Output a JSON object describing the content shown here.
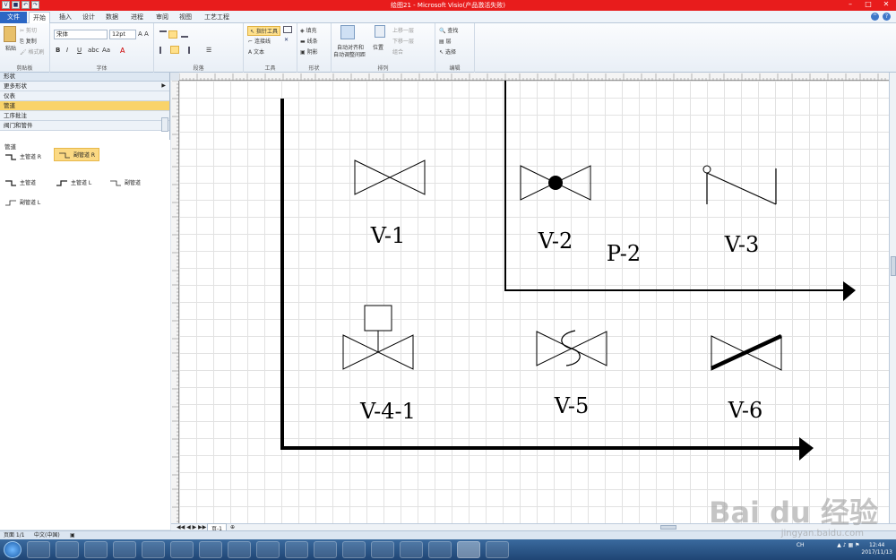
{
  "window": {
    "title": "绘图21 - Microsoft Visio(产品激活失败)"
  },
  "tabs": [
    "文件",
    "开始",
    "插入",
    "设计",
    "数据",
    "进程",
    "审阅",
    "视图",
    "工艺工程"
  ],
  "ribbon": {
    "clipboard": {
      "paste": "粘贴",
      "cut": "剪切",
      "copy": "复制",
      "format_painter": "格式刷",
      "label": "剪贴板"
    },
    "font": {
      "name": "宋体",
      "size": "12pt",
      "label": "字体"
    },
    "paragraph": {
      "label": "段落"
    },
    "tools": {
      "pointer": "指针工具",
      "connector": "连接线",
      "text": "文本",
      "label": "工具"
    },
    "shape": {
      "fill": "填充",
      "line": "线条",
      "shadow": "阴影",
      "label": "形状"
    },
    "arrange": {
      "auto_align": "自动对齐和",
      "auto_space": "自动调整间距",
      "position": "位置",
      "bring_forward": "上移一层",
      "send_backward": "下移一层",
      "group": "组合",
      "label": "排列"
    },
    "editing": {
      "find": "查找",
      "layers": "层",
      "select": "选择",
      "label": "编辑"
    }
  },
  "sidebar": {
    "header": "形状",
    "rows": [
      "更多形状",
      "仪表",
      "管道",
      "工序批注",
      "阀门和管件"
    ],
    "active_index": 2,
    "stencil_title": "管道",
    "shapes": [
      "主管道 R",
      "副管道 R",
      "主管道",
      "主管道 L",
      "副管道",
      "副管道 L"
    ]
  },
  "drawing": {
    "labels": [
      "V-1",
      "V-2",
      "P-2",
      "V-3",
      "V-4-1",
      "V-5",
      "V-6"
    ]
  },
  "pagebar": {
    "page_tab": "页-1"
  },
  "status": {
    "page": "页面 1/1",
    "lang": "中文(中国)"
  },
  "taskbar": {
    "time": "12:44",
    "date": "2017/11/13",
    "ime": "CH"
  },
  "watermark": {
    "brand": "Bai du 经验",
    "url": "jingyan.baidu.com"
  }
}
